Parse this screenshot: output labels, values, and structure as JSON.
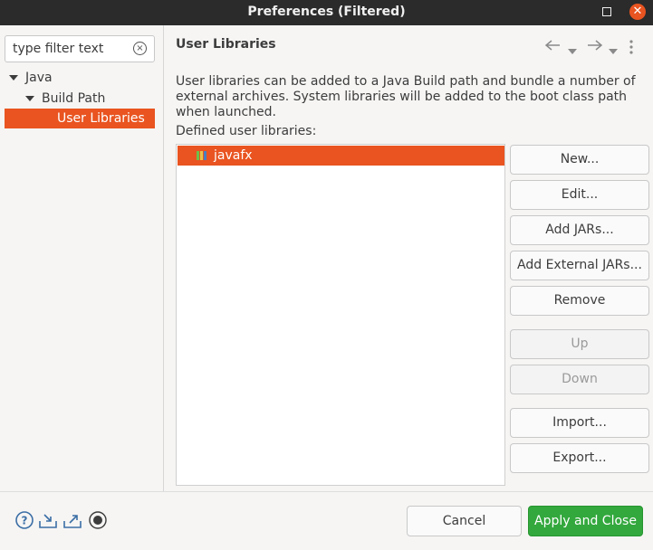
{
  "window": {
    "title": "Preferences (Filtered)",
    "close_icon": "close-icon",
    "maximize_icon": "maximize-icon"
  },
  "filter": {
    "placeholder": "type filter text",
    "clear_icon": "clear-icon"
  },
  "tree": {
    "items": [
      {
        "label": "Java",
        "expanded": true
      },
      {
        "label": "Build Path",
        "expanded": true
      },
      {
        "label": "User Libraries",
        "selected": true
      }
    ]
  },
  "page": {
    "title": "User Libraries",
    "description": "User libraries can be added to a Java Build path and bundle a number of external archives. System libraries will be added to the boot class path when launched.",
    "defined_label": "Defined user libraries:",
    "libraries": [
      {
        "name": "javafx",
        "icon": "library-icon",
        "selected": true
      }
    ]
  },
  "buttons": {
    "new": "New...",
    "edit": "Edit...",
    "add_jars": "Add JARs...",
    "add_external_jars": "Add External JARs...",
    "remove": "Remove",
    "up": "Up",
    "down": "Down",
    "import": "Import...",
    "export": "Export..."
  },
  "footer": {
    "cancel": "Cancel",
    "apply_close": "Apply and Close",
    "icons": [
      "help-icon",
      "import-icon",
      "export-icon",
      "record-icon"
    ]
  },
  "colors": {
    "accent": "#e95420",
    "apply": "#33a83d",
    "titlebar": "#2b2b2b"
  }
}
